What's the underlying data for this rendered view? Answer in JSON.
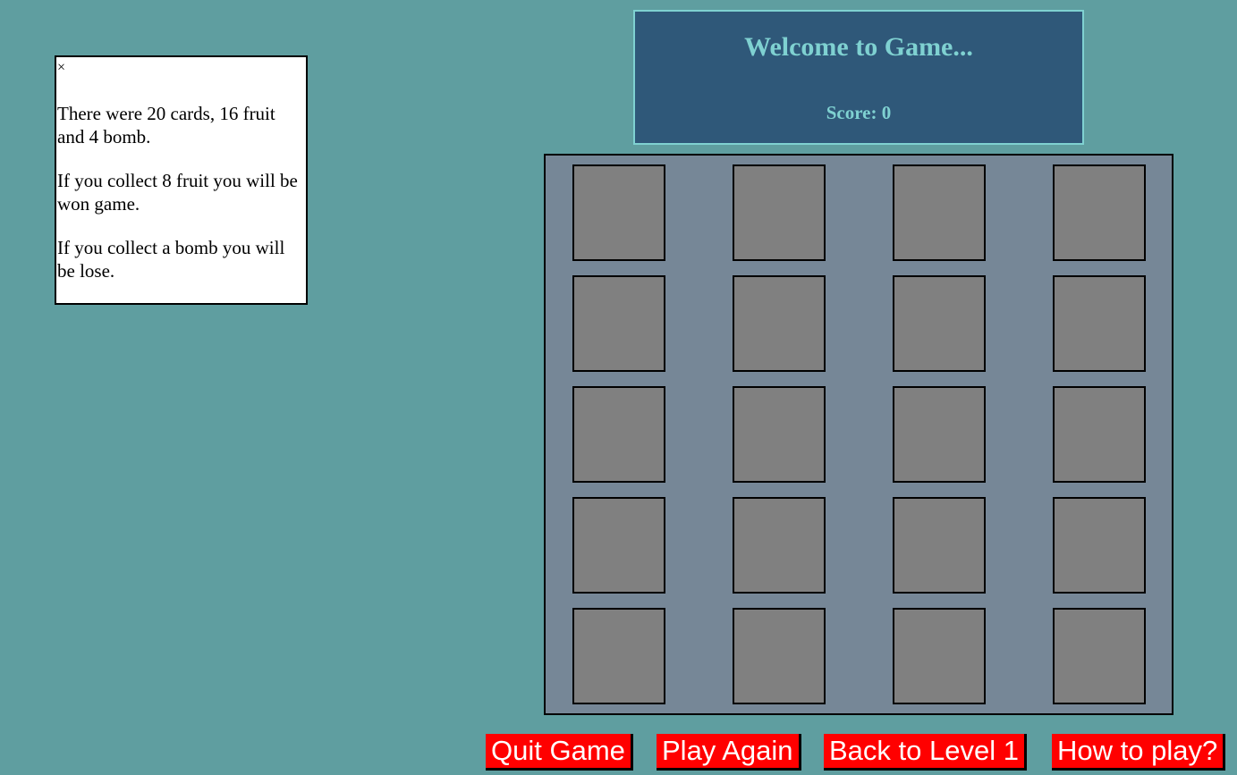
{
  "info": {
    "close_glyph": "×",
    "paragraphs": [
      "There were 20 cards, 16 fruit and 4 bomb.",
      "If you collect 8 fruit you will be won game.",
      "If you collect a bomb you will be lose."
    ]
  },
  "header": {
    "title": "Welcome to Game...",
    "score_text": "Score: 0"
  },
  "board": {
    "rows": 5,
    "cols": 4,
    "card_count": 20,
    "card_state": "face-down"
  },
  "buttons": {
    "quit": "Quit Game",
    "play_again": "Play Again",
    "back_level": "Back to Level 1",
    "how_to_play": "How to play?"
  },
  "colors": {
    "background": "#5f9ea0",
    "header_bg": "#2f5879",
    "header_text": "#7fd1d1",
    "board_bg": "#768797",
    "card_back": "#808080",
    "button_bg": "#ff0000",
    "button_text": "#ffffff"
  }
}
